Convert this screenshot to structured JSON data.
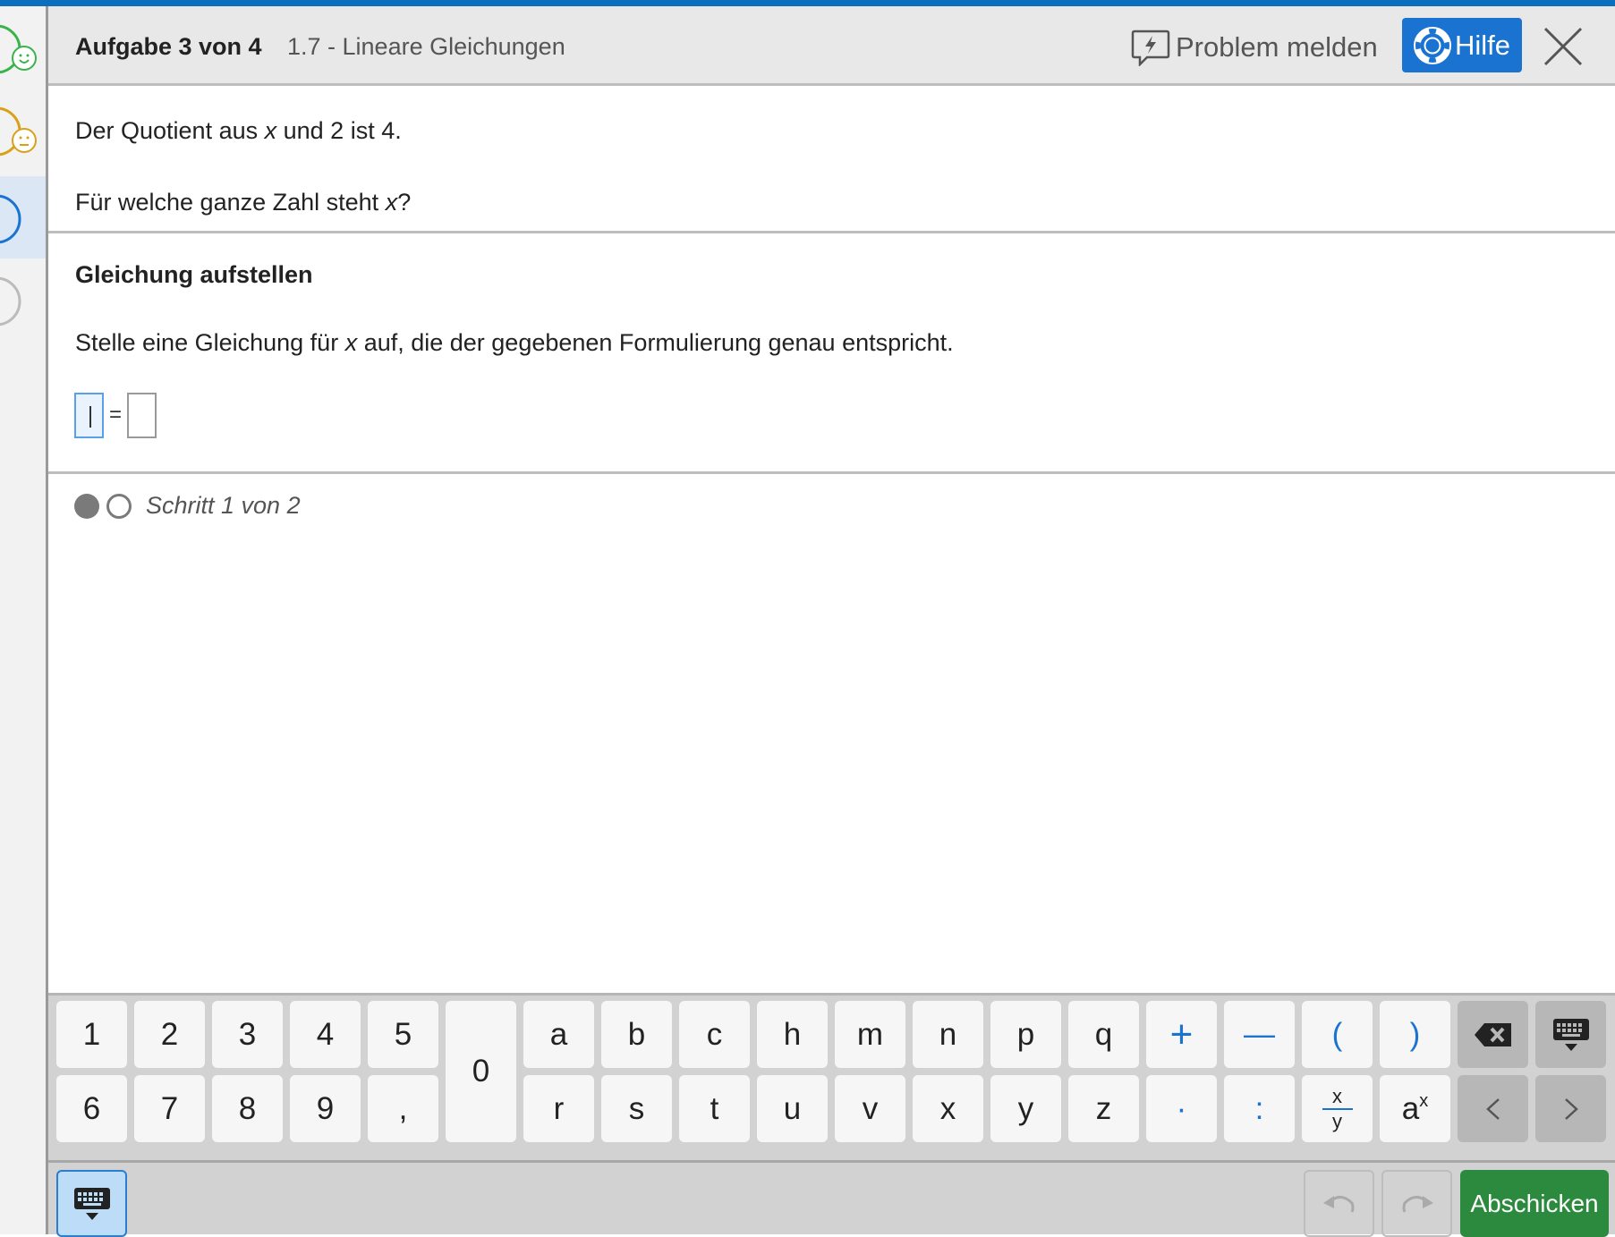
{
  "header": {
    "task_counter": "Aufgabe 3 von 4",
    "topic": "1.7 - Lineare Gleichungen",
    "report_label": "Problem melden",
    "help_label": "Hilfe"
  },
  "problem": {
    "line1": [
      "Der Quotient aus ",
      "x",
      " und 2 ist 4."
    ],
    "line2": [
      "Für welche ganze Zahl steht ",
      "x",
      "?"
    ]
  },
  "step": {
    "title": "Gleichung aufstellen",
    "instruction": [
      "Stelle eine Gleichung für ",
      "x",
      " auf, die der gegebenen Formulierung genau entspricht."
    ],
    "equation_sign": "=",
    "left_value": "",
    "right_value": ""
  },
  "progress": {
    "label": "Schritt 1 von 2",
    "current": 1,
    "total": 2
  },
  "keyboard": {
    "digits_row1": [
      "1",
      "2",
      "3",
      "4",
      "5"
    ],
    "digits_row2": [
      "6",
      "7",
      "8",
      "9",
      ","
    ],
    "zero": "0",
    "letters_row1": [
      "a",
      "b",
      "c",
      "h",
      "m",
      "n",
      "p",
      "q"
    ],
    "letters_row2": [
      "r",
      "s",
      "t",
      "u",
      "v",
      "x",
      "y",
      "z"
    ],
    "ops_row1": [
      "+",
      "—",
      "(",
      ")"
    ],
    "ops_row2": [
      "·",
      ":"
    ],
    "fraction": {
      "num": "x",
      "den": "y"
    },
    "power": {
      "base": "a",
      "exp": "x"
    },
    "icons": [
      "backspace-icon",
      "keyboard-hide-icon",
      "arrow-left-icon",
      "arrow-right-icon"
    ]
  },
  "bottom": {
    "submit_label": "Abschicken",
    "icons": [
      "keyboard-icon",
      "undo-icon",
      "redo-icon"
    ]
  },
  "rail": {
    "items": [
      {
        "status": "done-happy",
        "color": "#39b34a"
      },
      {
        "status": "done-neutral",
        "color": "#d9a11a"
      },
      {
        "status": "current",
        "color": "#1a73d1"
      },
      {
        "status": "open",
        "color": "#bbbbbb"
      }
    ]
  },
  "colors": {
    "accent": "#1a73d1",
    "top_bar": "#0a6fbd",
    "submit": "#2b8a3e"
  }
}
